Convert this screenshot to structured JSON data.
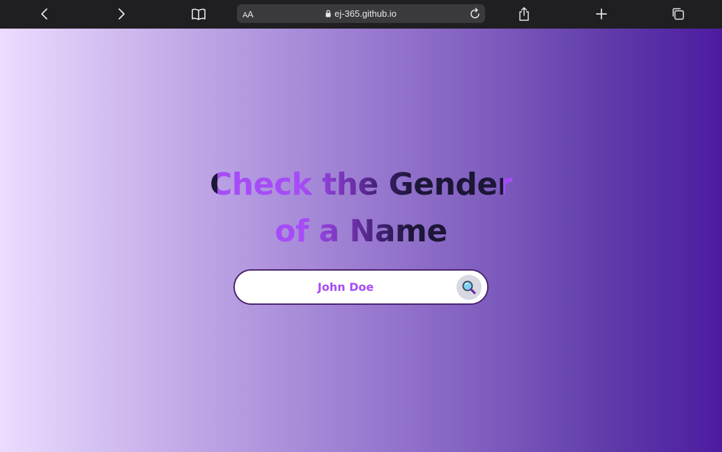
{
  "browser": {
    "url": "ej-365.github.io",
    "reader_label_small": "A",
    "reader_label_big": "A",
    "icons": [
      "back-icon",
      "forward-icon",
      "bookmarks-icon",
      "lock-icon",
      "reload-icon",
      "share-icon",
      "new-tab-icon",
      "tabs-icon"
    ]
  },
  "page": {
    "title_line1": "Check the Gender",
    "title_line2": "of a Name",
    "search": {
      "placeholder": "John Doe",
      "value": ""
    },
    "colors": {
      "title_start": "#a64cf7",
      "title_end": "#1c1637",
      "bg_left": "#ecdcff",
      "bg_right": "#4d1ba0",
      "input_text": "#a64cf7",
      "search_border": "#4a2370"
    }
  }
}
